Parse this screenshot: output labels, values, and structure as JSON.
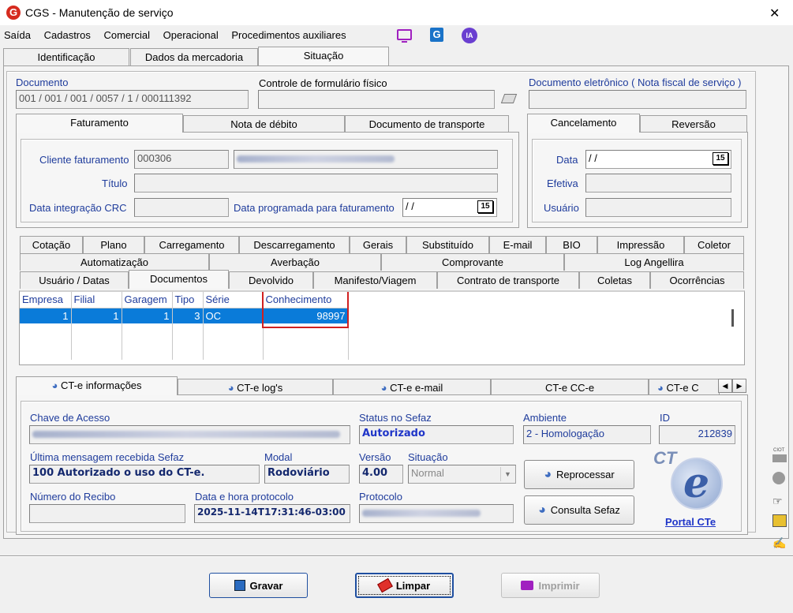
{
  "window": {
    "title": "CGS - Manutenção de serviço",
    "close": "✕"
  },
  "menu": [
    "Saída",
    "Cadastros",
    "Comercial",
    "Operacional",
    "Procedimentos auxiliares"
  ],
  "menu_icons": [
    "monitor-icon",
    "g-logo-icon",
    "ia-icon"
  ],
  "ia_label": "IA",
  "top_tabs": [
    "Identificação",
    "Dados da mercadoria",
    "Situação"
  ],
  "documento": {
    "label": "Documento",
    "value": "001 / 001 / 001 / 0057 / 1 / 000111392",
    "controle_label": "Controle de formulário físico",
    "eletronico_label": "Documento eletrônico ( Nota fiscal de serviço )"
  },
  "fat_tabs": [
    "Faturamento",
    "Nota de débito",
    "Documento de transporte"
  ],
  "faturamento": {
    "cliente_label": "Cliente faturamento",
    "cliente_code": "000306",
    "titulo_label": "Título",
    "crc_label": "Data integração CRC",
    "prog_label": "Data programada para faturamento",
    "prog_value": " /  /",
    "cal_label": "15"
  },
  "cancel_tabs": [
    "Cancelamento",
    "Reversão"
  ],
  "cancelamento": {
    "data_label": "Data",
    "data_value": " /  /",
    "efetiva_label": "Efetiva",
    "usuario_label": "Usuário"
  },
  "tabs_row1": [
    "Cotação",
    "Plano",
    "Carregamento",
    "Descarregamento",
    "Gerais",
    "Substituído",
    "E-mail",
    "BIO",
    "Impressão",
    "Coletor"
  ],
  "tabs_row2": [
    "Automatização",
    "Averbação",
    "Comprovante",
    "Log Angellira"
  ],
  "tabs_row3": [
    "Usuário / Datas",
    "Documentos",
    "Devolvido",
    "Manifesto/Viagem",
    "Contrato de transporte",
    "Coletas",
    "Ocorrências"
  ],
  "grid": {
    "columns": [
      "Empresa",
      "Filial",
      "Garagem",
      "Tipo",
      "Série",
      "Conhecimento"
    ],
    "rows": [
      [
        "1",
        "1",
        "1",
        "3",
        "OC",
        "98997"
      ]
    ]
  },
  "cte_tabs": [
    "CT-e informações",
    "CT-e log's",
    "CT-e e-mail",
    "CT-e CC-e",
    "CT-e C"
  ],
  "cte": {
    "chave_label": "Chave de Acesso",
    "status_label": "Status no Sefaz",
    "status_value": "Autorizado",
    "ambiente_label": "Ambiente",
    "ambiente_value": "2 - Homologação",
    "id_label": "ID",
    "id_value": "212839",
    "msg_label": "Última mensagem recebida Sefaz",
    "msg_value": "100 Autorizado o uso do CT-e.",
    "modal_label": "Modal",
    "modal_value": "Rodoviário",
    "versao_label": "Versão",
    "versao_value": "4.00",
    "situacao_label": "Situação",
    "situacao_value": "Normal",
    "recibo_label": "Número do Recibo",
    "datahora_label": "Data e hora protocolo",
    "datahora_value": "2025-11-14T17:31:46-03:00",
    "protocolo_label": "Protocolo",
    "reprocessar": "Reprocessar",
    "consulta": "Consulta Sefaz",
    "portal": "Portal CTe",
    "logo_text": "CT"
  },
  "side_label": "CIOT",
  "bottom": {
    "gravar": "Gravar",
    "limpar": "Limpar",
    "imprimir": "Imprimir"
  },
  "colors": {
    "accent_blue": "#1f35c8",
    "selection": "#0a7bd9",
    "highlight_border": "#d02020",
    "logo_red": "#d62b1f"
  }
}
